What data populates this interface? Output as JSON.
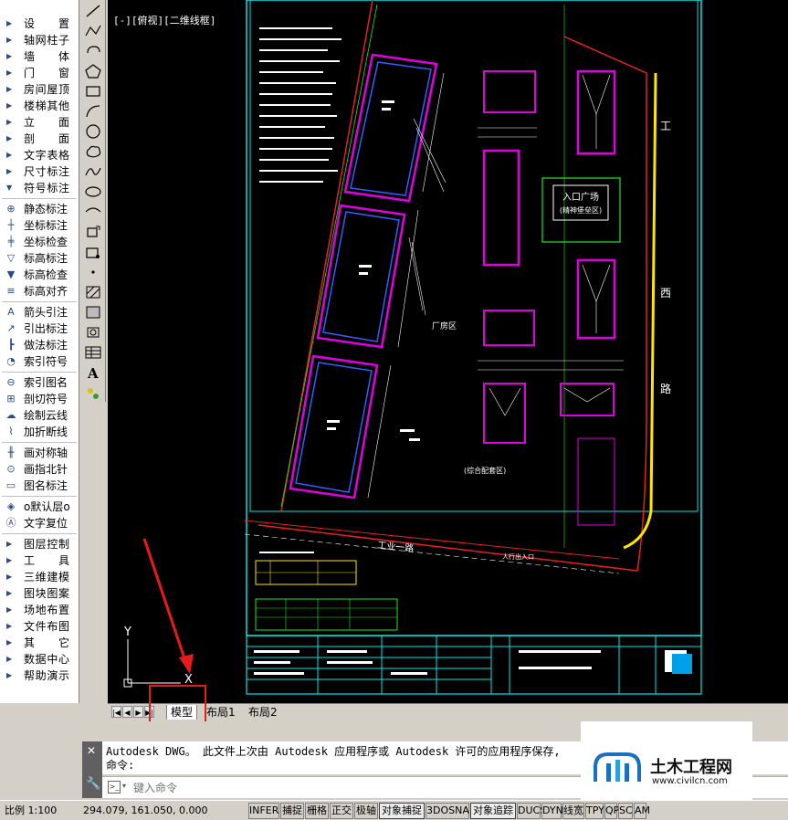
{
  "menu_items": [
    {
      "label": "设  置",
      "icon": "arrow-icon"
    },
    {
      "label": "轴网柱子",
      "icon": "arrow-icon"
    },
    {
      "label": "墙  体",
      "icon": "arrow-icon"
    },
    {
      "label": "门  窗",
      "icon": "arrow-icon"
    },
    {
      "label": "房间屋顶",
      "icon": "arrow-icon"
    },
    {
      "label": "楼梯其他",
      "icon": "arrow-icon"
    },
    {
      "label": "立  面",
      "icon": "arrow-icon"
    },
    {
      "label": "剖  面",
      "icon": "arrow-icon"
    },
    {
      "label": "文字表格",
      "icon": "arrow-icon"
    },
    {
      "label": "尺寸标注",
      "icon": "arrow-icon"
    },
    {
      "label": "符号标注",
      "icon": "arrow-down-icon"
    }
  ],
  "tool_items": [
    {
      "label": "静态标注",
      "icon": "pin-icon"
    },
    {
      "label": "坐标标注",
      "icon": "coord-icon"
    },
    {
      "label": "坐标检查",
      "icon": "coord-check-icon"
    },
    {
      "label": "标高标注",
      "icon": "elevation-icon"
    },
    {
      "label": "标高检查",
      "icon": "elevation-check-icon"
    },
    {
      "label": "标高对齐",
      "icon": "elevation-align-icon"
    },
    {
      "label": "箭头引注",
      "icon": "arrow-leader-icon"
    },
    {
      "label": "引出标注",
      "icon": "leader-icon"
    },
    {
      "label": "做法标注",
      "icon": "method-icon"
    },
    {
      "label": "索引符号",
      "icon": "index-symbol-icon"
    },
    {
      "label": "索引图名",
      "icon": "index-name-icon"
    },
    {
      "label": "剖切符号",
      "icon": "section-symbol-icon"
    },
    {
      "label": "绘制云线",
      "icon": "cloud-icon"
    },
    {
      "label": "加折断线",
      "icon": "break-line-icon"
    },
    {
      "label": "画对称轴",
      "icon": "symmetry-icon"
    },
    {
      "label": "画指北针",
      "icon": "north-arrow-icon"
    },
    {
      "label": "图名标注",
      "icon": "title-icon"
    },
    {
      "label": "o默认层o",
      "icon": "layer-icon"
    },
    {
      "label": "文字复位",
      "icon": "text-reset-icon"
    }
  ],
  "bottom_menu_items": [
    {
      "label": "图层控制"
    },
    {
      "label": "工  具"
    },
    {
      "label": "三维建模"
    },
    {
      "label": "图块图案"
    },
    {
      "label": "场地布置"
    },
    {
      "label": "文件布图"
    },
    {
      "label": "其  它"
    },
    {
      "label": "数据中心"
    },
    {
      "label": "帮助演示"
    }
  ],
  "viewport": {
    "view_label": "[-][俯视][二维线框]",
    "annotations": {
      "entrance_plaza": "入口广场",
      "entrance_sub": "(精神堡垒区)",
      "factory_area": "厂房区",
      "living_area": "(综合配套区)",
      "road": "工业一路",
      "pedestrian": "人行出入口",
      "side_gong": "工",
      "side_lu": "路",
      "side_xi": "西",
      "ucs_y": "Y",
      "ucs_x": "X"
    }
  },
  "tabs": {
    "nav": [
      "|◀",
      "◀",
      "▶",
      "▶|"
    ],
    "items": [
      {
        "label": "模型",
        "active": true
      },
      {
        "label": "布局1",
        "active": false
      },
      {
        "label": "布局2",
        "active": false
      }
    ]
  },
  "command": {
    "history_line": "Autodesk DWG。  此文件上次由 Autodesk 应用程序或 Autodesk 许可的应用程序保存,",
    "prompt_line": "命令:",
    "placeholder": "键入命令"
  },
  "status_bar": {
    "scale": "比例 1:100",
    "coords": "294.079, 161.050, 0.000",
    "toggles": [
      {
        "label": "INFER",
        "on": false
      },
      {
        "label": "捕捉",
        "on": false
      },
      {
        "label": "栅格",
        "on": false
      },
      {
        "label": "正交",
        "on": false
      },
      {
        "label": "极轴",
        "on": false
      },
      {
        "label": "对象捕捉",
        "on": true
      },
      {
        "label": "3DOSNAP",
        "on": false
      },
      {
        "label": "对象追踪",
        "on": true
      },
      {
        "label": "DUCS",
        "on": false
      },
      {
        "label": "DYN",
        "on": false
      },
      {
        "label": "线宽",
        "on": false
      },
      {
        "label": "TPY",
        "on": false
      },
      {
        "label": "QP",
        "on": false
      },
      {
        "label": "SC",
        "on": false
      },
      {
        "label": "AM",
        "on": false
      }
    ]
  },
  "watermark": {
    "site_name": "土木工程网",
    "site_url": "www.civilcn.com"
  },
  "colors": {
    "background_canvas": "#000000",
    "highlight_red": "#e81b1b",
    "frame_cyan": "#00e5e5",
    "building_magenta": "#e000e0",
    "building_blue": "#3060ff",
    "green_text": "#1ee81e",
    "site_red": "#e82020",
    "yellow": "#ffe600"
  }
}
